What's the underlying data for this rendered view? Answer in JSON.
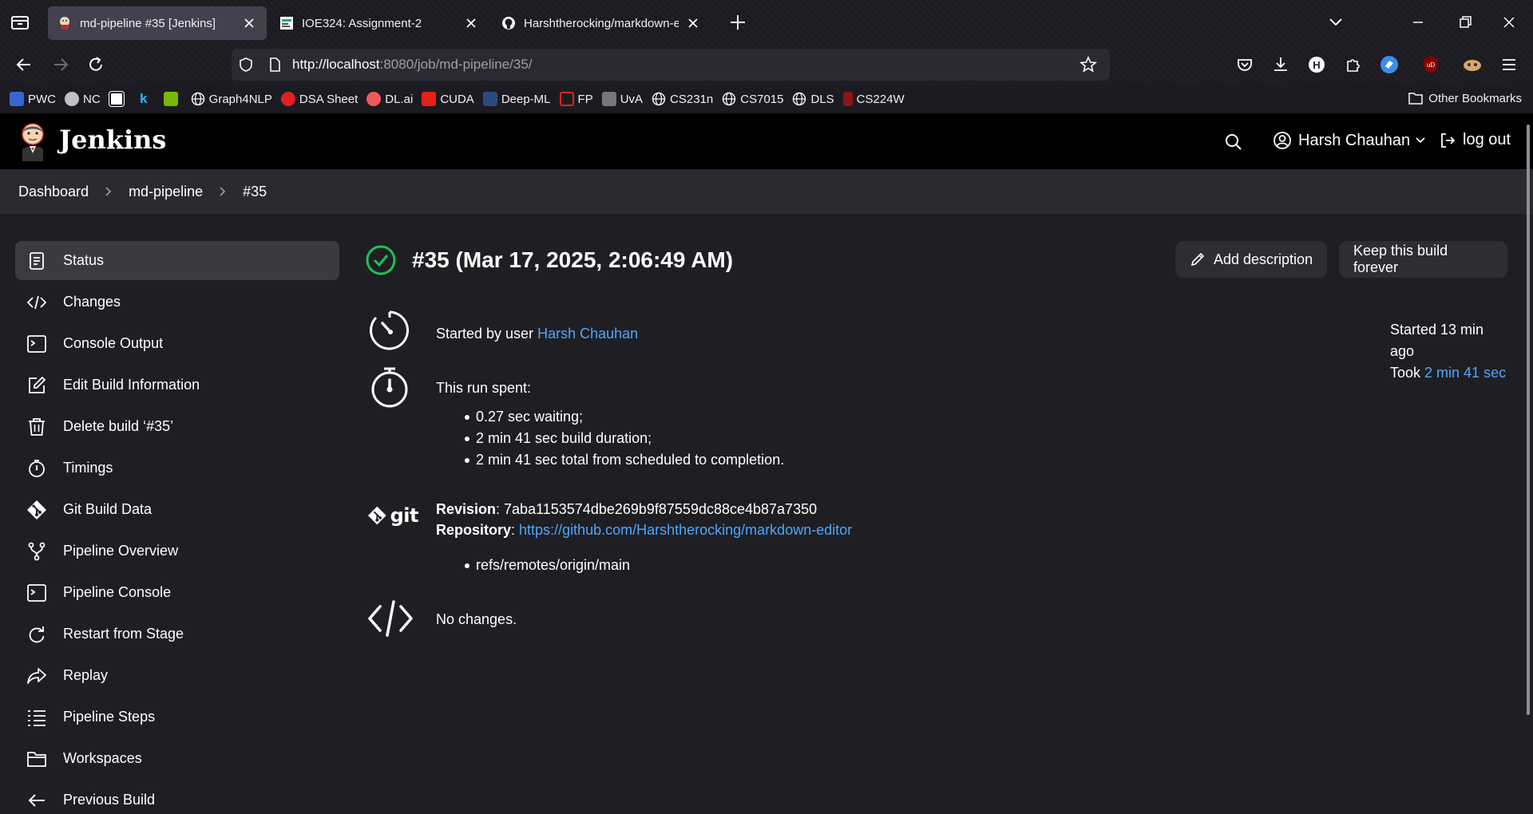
{
  "browser": {
    "tabs": [
      {
        "label": "md-pipeline #35 [Jenkins]",
        "active": true
      },
      {
        "label": "IOE324: Assignment-2",
        "active": false
      },
      {
        "label": "Harshtherocking/markdown-ed",
        "active": false
      }
    ],
    "url_host": "http://localhost",
    "url_rest": ":8080/job/md-pipeline/35/",
    "bookmarks": [
      "PWC",
      "NC",
      "",
      "",
      "",
      "Graph4NLP",
      "DSA Sheet",
      "DL.ai",
      "CUDA",
      "Deep-ML",
      "FP",
      "UvA",
      "CS231n",
      "CS7015",
      "DLS",
      "CS224W"
    ],
    "other_bookmarks": "Other Bookmarks"
  },
  "jenkins": {
    "brand": "Jenkins",
    "user": "Harsh Chauhan",
    "logout": "log out",
    "breadcrumbs": [
      "Dashboard",
      "md-pipeline",
      "#35"
    ],
    "sidenav": [
      {
        "label": "Status",
        "icon": "document-icon"
      },
      {
        "label": "Changes",
        "icon": "code-icon"
      },
      {
        "label": "Console Output",
        "icon": "terminal-icon"
      },
      {
        "label": "Edit Build Information",
        "icon": "edit-icon"
      },
      {
        "label": "Delete build ‘#35’",
        "icon": "trash-icon"
      },
      {
        "label": "Timings",
        "icon": "stopwatch-icon"
      },
      {
        "label": "Git Build Data",
        "icon": "git-icon"
      },
      {
        "label": "Pipeline Overview",
        "icon": "branch-icon"
      },
      {
        "label": "Pipeline Console",
        "icon": "terminal-icon"
      },
      {
        "label": "Restart from Stage",
        "icon": "restart-icon"
      },
      {
        "label": "Replay",
        "icon": "replay-icon"
      },
      {
        "label": "Pipeline Steps",
        "icon": "list-icon"
      },
      {
        "label": "Workspaces",
        "icon": "folder-icon"
      },
      {
        "label": "Previous Build",
        "icon": "arrow-left-icon"
      }
    ],
    "build": {
      "title": "#35 (Mar 17, 2025, 2:06:49 AM)",
      "add_description": "Add description",
      "keep_forever": "Keep this build forever",
      "started_by_prefix": "Started by user ",
      "started_by_user": "Harsh Chauhan",
      "started_ago": "Started 13 min ago",
      "took_prefix": "Took ",
      "took_value": "2 min 41 sec",
      "run_spent_heading": "This run spent:",
      "run_spent_items": [
        "0.27 sec waiting;",
        "2 min 41 sec build duration;",
        "2 min 41 sec total from scheduled to completion."
      ],
      "git_word": "git",
      "revision_label": "Revision",
      "revision_value": ": 7aba1153574dbe269b9f87559dc88ce4b87a7350",
      "repository_label": "Repository",
      "repository_sep": ": ",
      "repository_url": "https://github.com/Harshtherocking/markdown-editor",
      "branches": [
        "refs/remotes/origin/main"
      ],
      "no_changes": "No changes."
    }
  },
  "colors": {
    "accent_link": "#4ea6ff",
    "success": "#1ec15a",
    "header_bg": "#000000",
    "page_bg": "#1f1f23"
  }
}
